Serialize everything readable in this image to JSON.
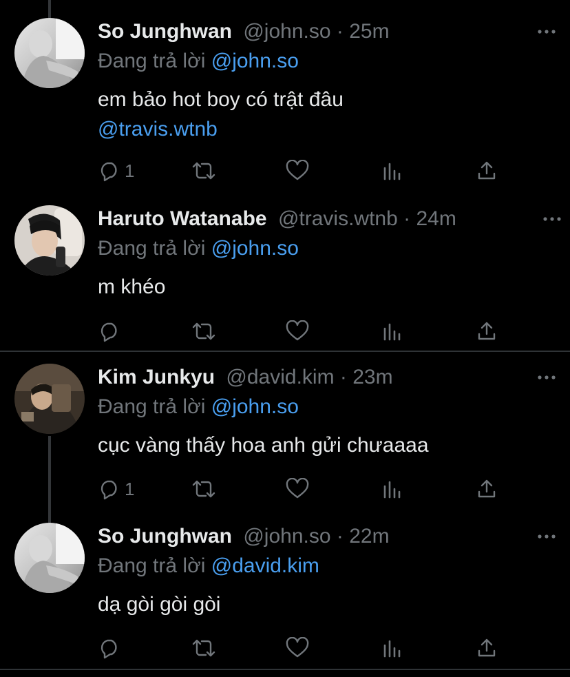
{
  "tweets": [
    {
      "name": "So Junghwan",
      "handle": "@john.so",
      "time": "25m",
      "reply_prefix": "Đang trả lời",
      "reply_to": "@john.so",
      "body_text": "em bảo hot boy có trật đâu",
      "body_mention": "@travis.wtnb",
      "reply_count": "1",
      "avatar_icon": "profile-photo-john-so"
    },
    {
      "name": "Haruto Watanabe",
      "handle": "@travis.wtnb",
      "time": "24m",
      "reply_prefix": "Đang trả lời",
      "reply_to": "@john.so",
      "body_text": "m khéo",
      "reply_count": "",
      "avatar_icon": "profile-photo-travis-wtnb"
    },
    {
      "name": "Kim Junkyu",
      "handle": "@david.kim",
      "time": "23m",
      "reply_prefix": "Đang trả lời",
      "reply_to": "@john.so",
      "body_text": "cục vàng thấy hoa anh gửi chưaaaa",
      "reply_count": "1",
      "avatar_icon": "profile-photo-david-kim"
    },
    {
      "name": "So Junghwan",
      "handle": "@john.so",
      "time": "22m",
      "reply_prefix": "Đang trả lời",
      "reply_to": "@david.kim",
      "body_text": "dạ gòi gòi gòi",
      "reply_count": "",
      "avatar_icon": "profile-photo-john-so"
    }
  ],
  "separator": "·",
  "colors": {
    "background": "#000000",
    "text": "#e7e9ea",
    "muted": "#71767b",
    "link": "#4a9ff0",
    "divider": "#2f3336"
  }
}
